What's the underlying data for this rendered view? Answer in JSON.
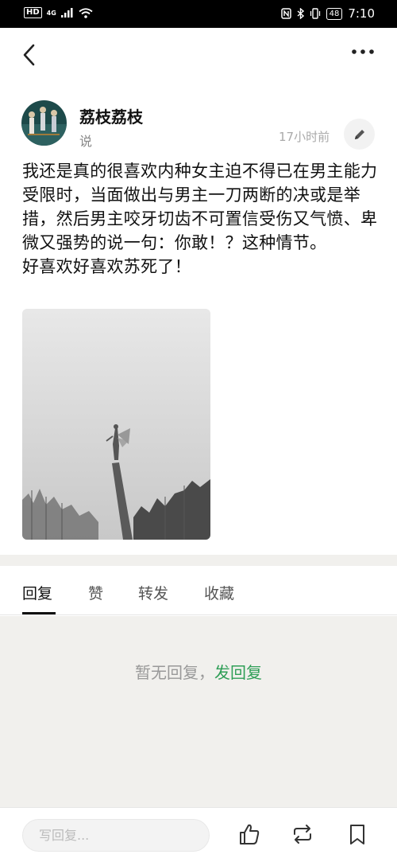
{
  "status_bar": {
    "hd": "HD",
    "network": "4G",
    "battery": "48",
    "time": "7:10"
  },
  "nav": {
    "back_icon": "chevron-left-icon",
    "more_icon": "more-dots-icon"
  },
  "post": {
    "author": "荔枝荔枝",
    "type": "说",
    "time": "17小时前",
    "text": "我还是真的很喜欢内种女主迫不得已在男主能力受限时，当面做出与男主一刀两断的决或是举措，然后男主咬牙切齿不可置信受伤又气愤、卑微又强势的说一句：你敢！？这种情节。\n好喜欢好喜欢苏死了！"
  },
  "tabs": [
    "回复",
    "赞",
    "转发",
    "收藏"
  ],
  "empty": {
    "text": "暂无回复，",
    "link": "发回复"
  },
  "bottom_bar": {
    "placeholder": "写回复...",
    "icons": [
      "like-icon",
      "repost-icon",
      "bookmark-icon"
    ]
  },
  "colors": {
    "accent_green": "#2e9e56",
    "page_gray": "#f1f0ed"
  }
}
